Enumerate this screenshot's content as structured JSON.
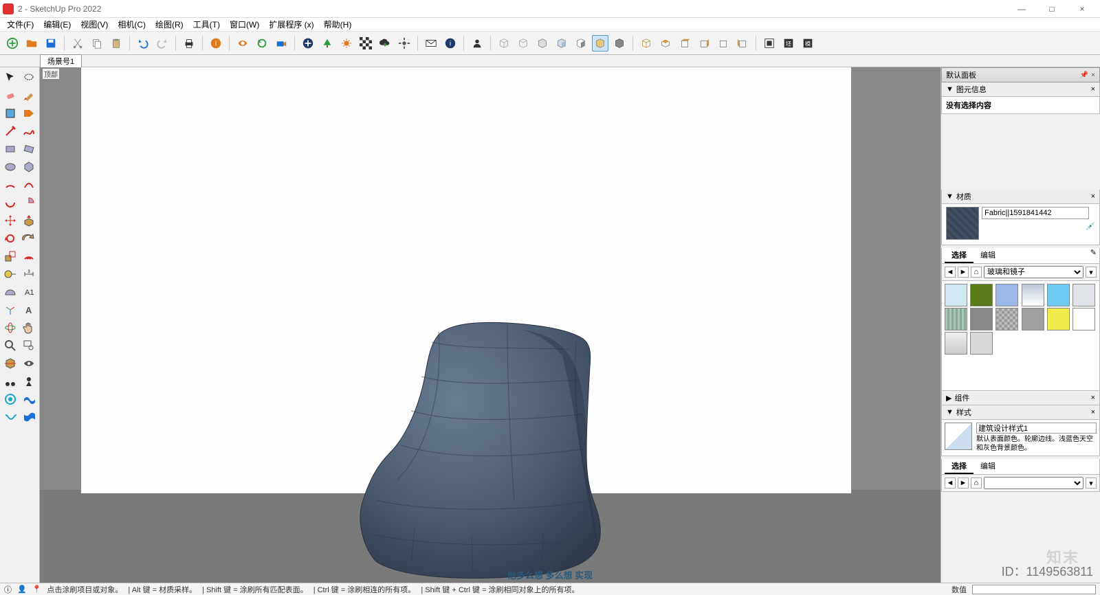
{
  "window": {
    "title": "2 - SketchUp Pro 2022",
    "minimize": "—",
    "maximize": "□",
    "close": "×"
  },
  "menubar": [
    "文件(F)",
    "编辑(E)",
    "视图(V)",
    "相机(C)",
    "绘图(R)",
    "工具(T)",
    "窗口(W)",
    "扩展程序 (x)",
    "帮助(H)"
  ],
  "scene_tab": "场景号1",
  "viewport_small_label": "顶部",
  "panels": {
    "tray_title": "默认面板",
    "entity_info": {
      "title": "图元信息",
      "empty": "没有选择内容"
    },
    "materials": {
      "title": "材质",
      "name": "Fabric||1591841442",
      "tab_select": "选择",
      "tab_edit": "编辑",
      "collection": "玻璃和镜子",
      "swatches": [
        "#cfe8f2",
        "#5a7a1a",
        "#9cb8e8",
        "#bcc8d8",
        "#6ecaf2",
        "#e0e4e8",
        "#a8c8b8",
        "#888888",
        "#b0b0b0",
        "#a0a0a0",
        "#f2ea4a",
        "#ffffff",
        "#e8e8e8",
        "#d8d8d8"
      ]
    },
    "components": {
      "title": "组件"
    },
    "styles": {
      "title": "样式",
      "name": "建筑设计样式1",
      "desc": "默认表面颜色。轮廓边线。浅蓝色天空和灰色背景颜色。",
      "tab_select": "选择",
      "tab_edit": "编辑"
    }
  },
  "statusbar": {
    "hint_main": "点击涂刷项目或对象。",
    "hint_alt": "| Alt 键 = 材质采样。",
    "hint_shift": "| Shift 键 = 涂刷所有匹配表面。",
    "hint_ctrl": "| Ctrl 键 = 涂刷相连的所有项。",
    "hint_shiftctrl": "| Shift 键 + Ctrl 键 = 涂刷相同对象上的所有项。",
    "measure_label": "数值"
  },
  "overlay": {
    "bottom_hint": "他多么想  多么想  实现",
    "id": "ID：1149563811",
    "brand": "知末"
  }
}
